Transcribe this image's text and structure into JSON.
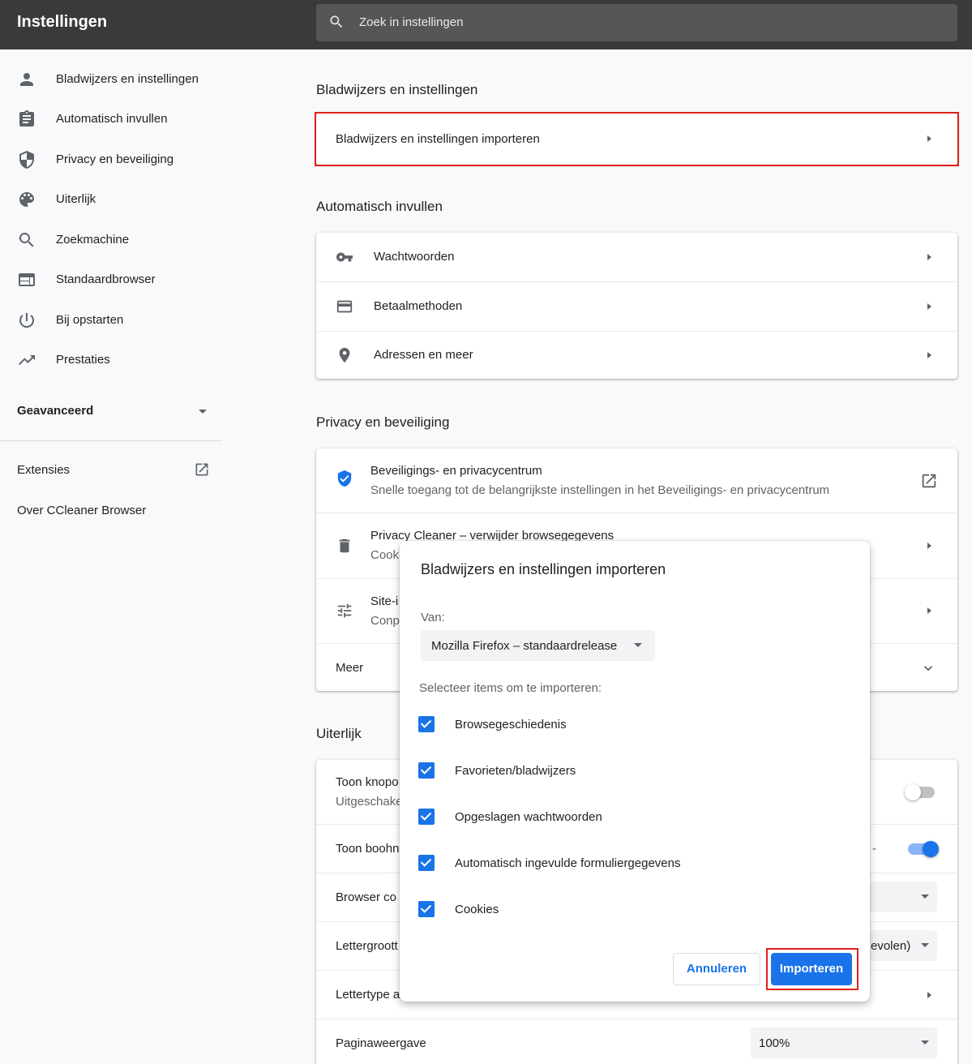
{
  "app": {
    "title": "Instellingen"
  },
  "search": {
    "placeholder": "Zoek in instellingen"
  },
  "sidebar": {
    "items": [
      {
        "label": "Bladwijzers en instellingen",
        "icon": "person-icon"
      },
      {
        "label": "Automatisch invullen",
        "icon": "clipboard-icon"
      },
      {
        "label": "Privacy en beveiliging",
        "icon": "shield-icon"
      },
      {
        "label": "Uiterlijk",
        "icon": "palette-icon"
      },
      {
        "label": "Zoekmachine",
        "icon": "search-icon"
      },
      {
        "label": "Standaardbrowser",
        "icon": "browser-window-icon"
      },
      {
        "label": "Bij opstarten",
        "icon": "power-icon"
      },
      {
        "label": "Prestaties",
        "icon": "trending-icon"
      }
    ],
    "advanced": "Geavanceerd",
    "extensions": "Extensies",
    "about": "Over CCleaner Browser"
  },
  "main": {
    "bookmarks": {
      "title": "Bladwijzers en instellingen",
      "import_row": "Bladwijzers en instellingen importeren"
    },
    "autofill": {
      "title": "Automatisch invullen",
      "rows": [
        "Wachtwoorden",
        "Betaalmethoden",
        "Adressen en meer"
      ]
    },
    "privacy": {
      "title": "Privacy en beveiliging",
      "security_center": {
        "label": "Beveiligings- en privacycentrum",
        "sub": "Snelle toegang tot de belangrijkste instellingen in het Beveiligings- en privacycentrum"
      },
      "cleaner": {
        "label": "Privacy Cleaner – verwijder browsegegevens",
        "sub": "Cooki"
      },
      "site": {
        "label": "Site-i",
        "sub": "Conp"
      },
      "more": "Meer"
    },
    "appearance": {
      "title": "Uiterlijk",
      "rows": [
        {
          "label": "Toon knopo",
          "sub": "Uitgeschake"
        },
        {
          "label": "Toon boohn",
          "dash": "-"
        },
        {
          "label": "Browser co"
        },
        {
          "label": "Lettergroott",
          "value": "evolen)"
        },
        {
          "label": "Lettertype a"
        },
        {
          "label": "Paginaweergave",
          "value": "100%"
        }
      ],
      "toggle1_on": false,
      "toggle2_on": true
    }
  },
  "dialog": {
    "title": "Bladwijzers en instellingen importeren",
    "from_label": "Van:",
    "source": "Mozilla Firefox – standaardrelease",
    "select_label": "Selecteer items om te importeren:",
    "items": [
      {
        "label": "Browsegeschiedenis",
        "checked": true
      },
      {
        "label": "Favorieten/bladwijzers",
        "checked": true
      },
      {
        "label": "Opgeslagen wachtwoorden",
        "checked": true
      },
      {
        "label": "Automatisch ingevulde formuliergegevens",
        "checked": true
      },
      {
        "label": "Cookies",
        "checked": true
      }
    ],
    "cancel": "Annuleren",
    "import": "Importeren"
  },
  "colors": {
    "accent": "#1a73e8",
    "highlight": "#e0201c",
    "topbar": "#3a3a3a"
  }
}
